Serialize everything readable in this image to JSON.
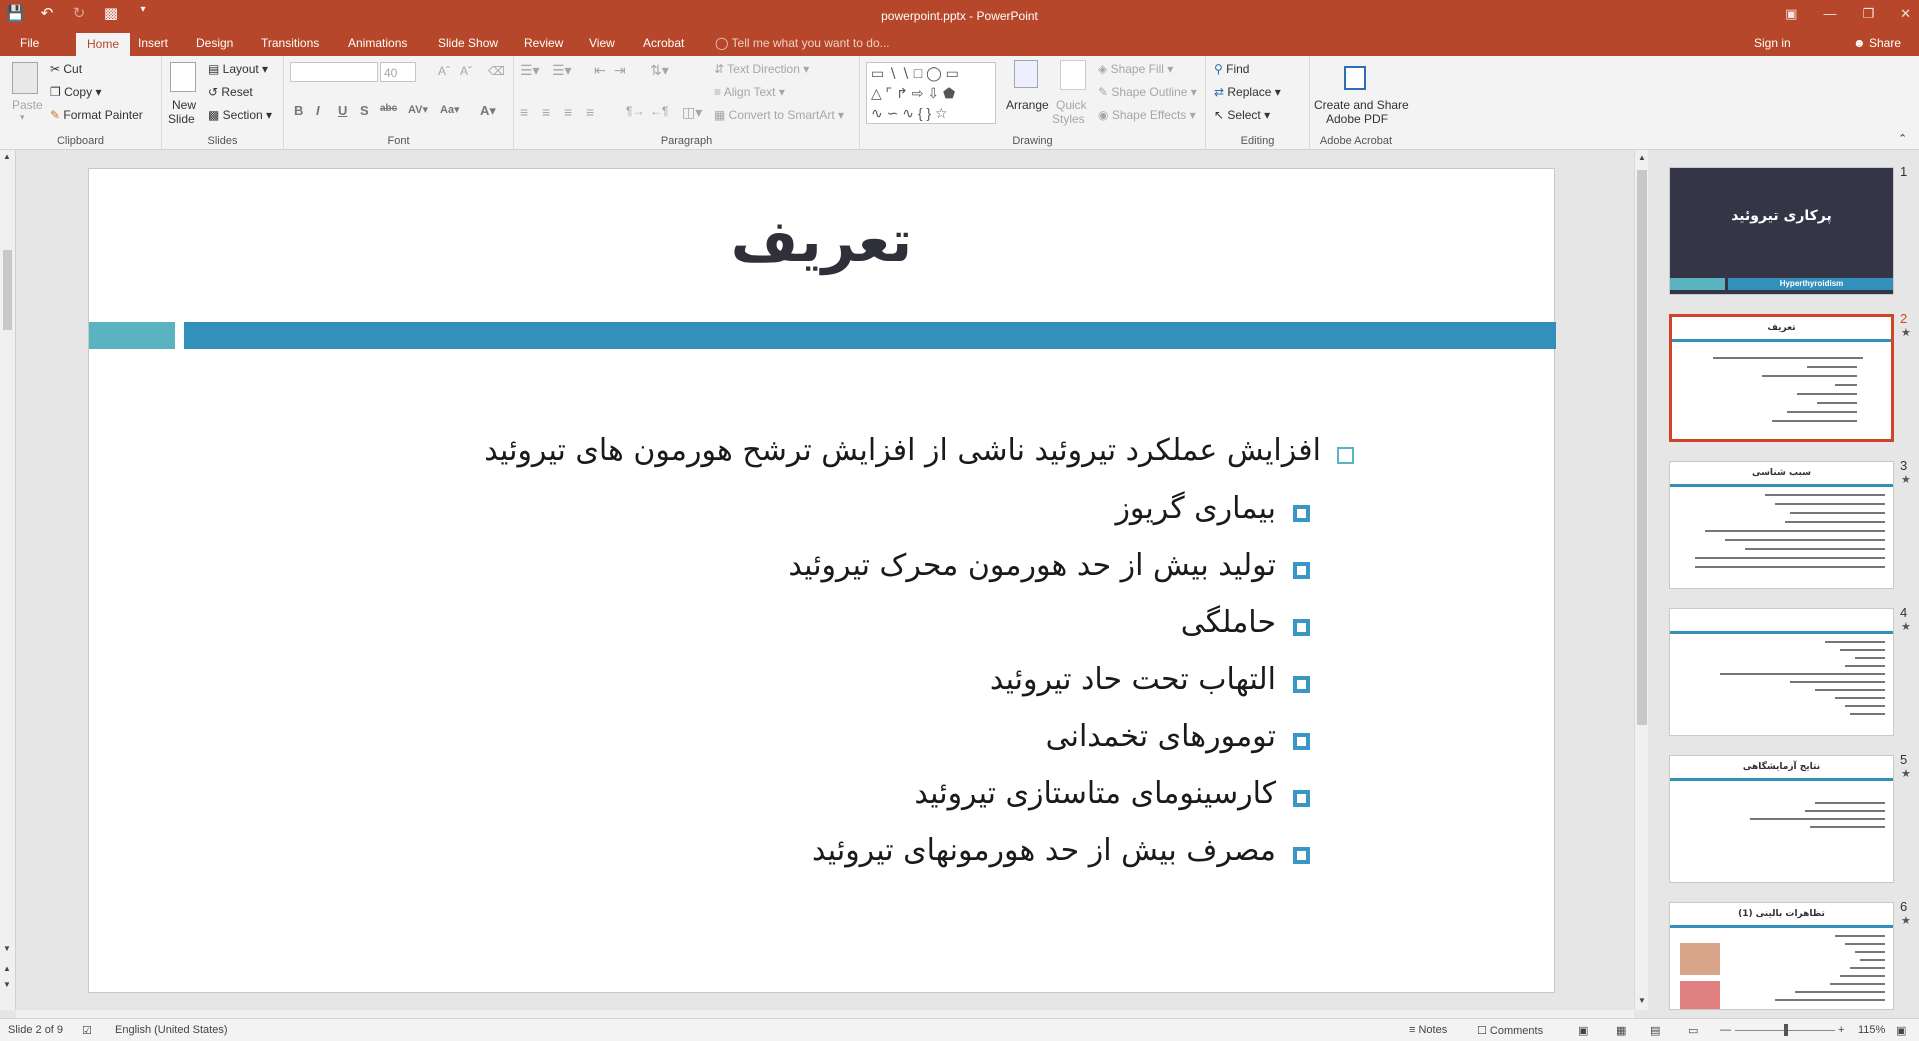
{
  "window": {
    "title": "powerpoint.pptx - PowerPoint"
  },
  "tabs": [
    "File",
    "Home",
    "Insert",
    "Design",
    "Transitions",
    "Animations",
    "Slide Show",
    "Review",
    "View",
    "Acrobat"
  ],
  "active_tab": "Home",
  "tell_me": "Tell me what you want to do...",
  "account": {
    "sign_in": "Sign in",
    "share": "Share"
  },
  "ribbon": {
    "clipboard": {
      "paste": "Paste",
      "cut": "Cut",
      "copy": "Copy",
      "format_painter": "Format Painter",
      "label": "Clipboard"
    },
    "slides": {
      "new_slide_1": "New",
      "new_slide_2": "Slide",
      "layout": "Layout",
      "reset": "Reset",
      "section": "Section",
      "label": "Slides"
    },
    "font": {
      "font_name": "",
      "font_size": "40",
      "label": "Font"
    },
    "paragraph": {
      "text_direction": "Text Direction",
      "align_text": "Align Text",
      "convert_smartart": "Convert to SmartArt",
      "label": "Paragraph"
    },
    "drawing": {
      "arrange": "Arrange",
      "quick_styles_1": "Quick",
      "quick_styles_2": "Styles",
      "shape_fill": "Shape Fill",
      "shape_outline": "Shape Outline",
      "shape_effects": "Shape Effects",
      "label": "Drawing"
    },
    "editing": {
      "find": "Find",
      "replace": "Replace",
      "select": "Select",
      "label": "Editing"
    },
    "acrobat": {
      "create_share_1": "Create and Share",
      "create_share_2": "Adobe PDF",
      "label": "Adobe Acrobat"
    }
  },
  "slide": {
    "title": "تعریف",
    "main_bullet": "افزایش عملکرد تیروئید ناشی از افزایش ترشح هورمون های تیروئید",
    "sub_bullets": [
      "بیماری گریوز",
      "تولید بیش از حد هورمون محرک تیروئید",
      "حاملگی",
      "التهاب تحت حاد تیروئید",
      "تومورهای تخمدانی",
      "کارسینومای متاستازی تیروئید",
      "مصرف بیش از حد هورمونهای تیروئید"
    ]
  },
  "thumbnails": {
    "t1_title": "پرکاری تیروئید",
    "t1_sub": "Hyperthyroidism",
    "t2_title": "تعریف",
    "t3_title": "سبب شناسی",
    "t5_title": "نتایج آزمایشگاهی",
    "t6_title": "تظاهرات بالینی (1)",
    "numbers": [
      "1",
      "2",
      "3",
      "4",
      "5",
      "6"
    ]
  },
  "status": {
    "slide_of": "Slide 2 of 9",
    "language": "English (United States)",
    "notes": "Notes",
    "comments": "Comments",
    "zoom": "115%"
  },
  "colors": {
    "accent": "#b7472a",
    "bar_blue": "#3390bb",
    "bar_teal": "#5ab3bf",
    "title_dark": "#30303b"
  }
}
